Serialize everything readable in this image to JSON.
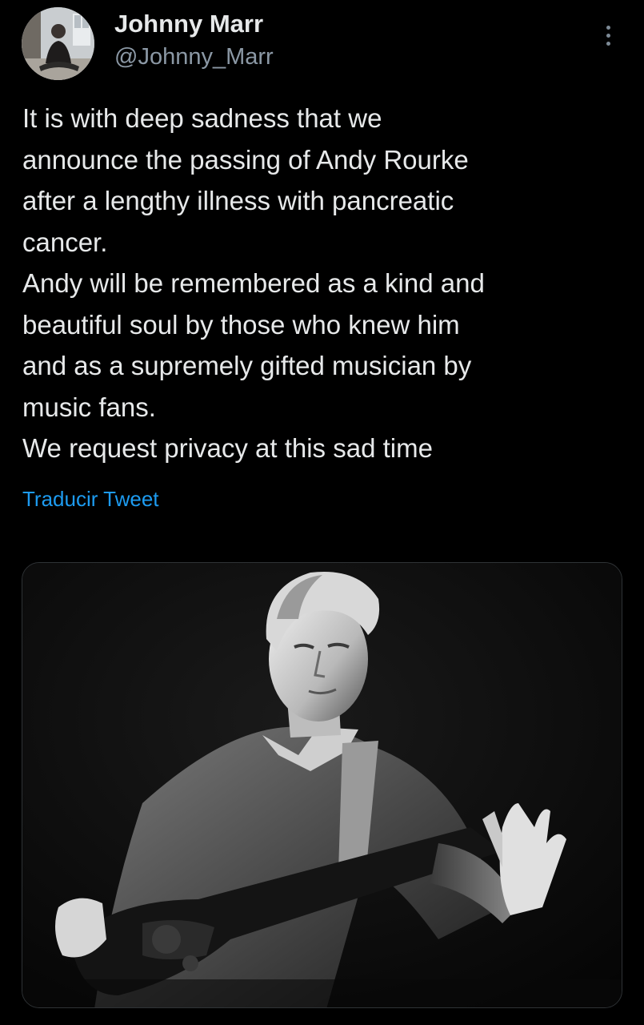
{
  "author": {
    "name": "Johnny Marr",
    "handle": "@Johnny_Marr"
  },
  "tweet": {
    "lines": [
      "It is with deep sadness that we",
      "announce the passing of Andy Rourke",
      "after a lengthy illness with pancreatic",
      "cancer.",
      "Andy will be remembered as a kind and",
      "beautiful soul by those who knew him",
      "and as a supremely gifted musician by",
      "music fans.",
      "We request privacy at this sad time"
    ],
    "translate_label": "Traducir Tweet"
  },
  "icons": {
    "more": "more-dots-icon"
  },
  "colors": {
    "background": "#000000",
    "text": "#e7e9ea",
    "secondary": "#8b98a5",
    "link": "#1d9bf0"
  }
}
